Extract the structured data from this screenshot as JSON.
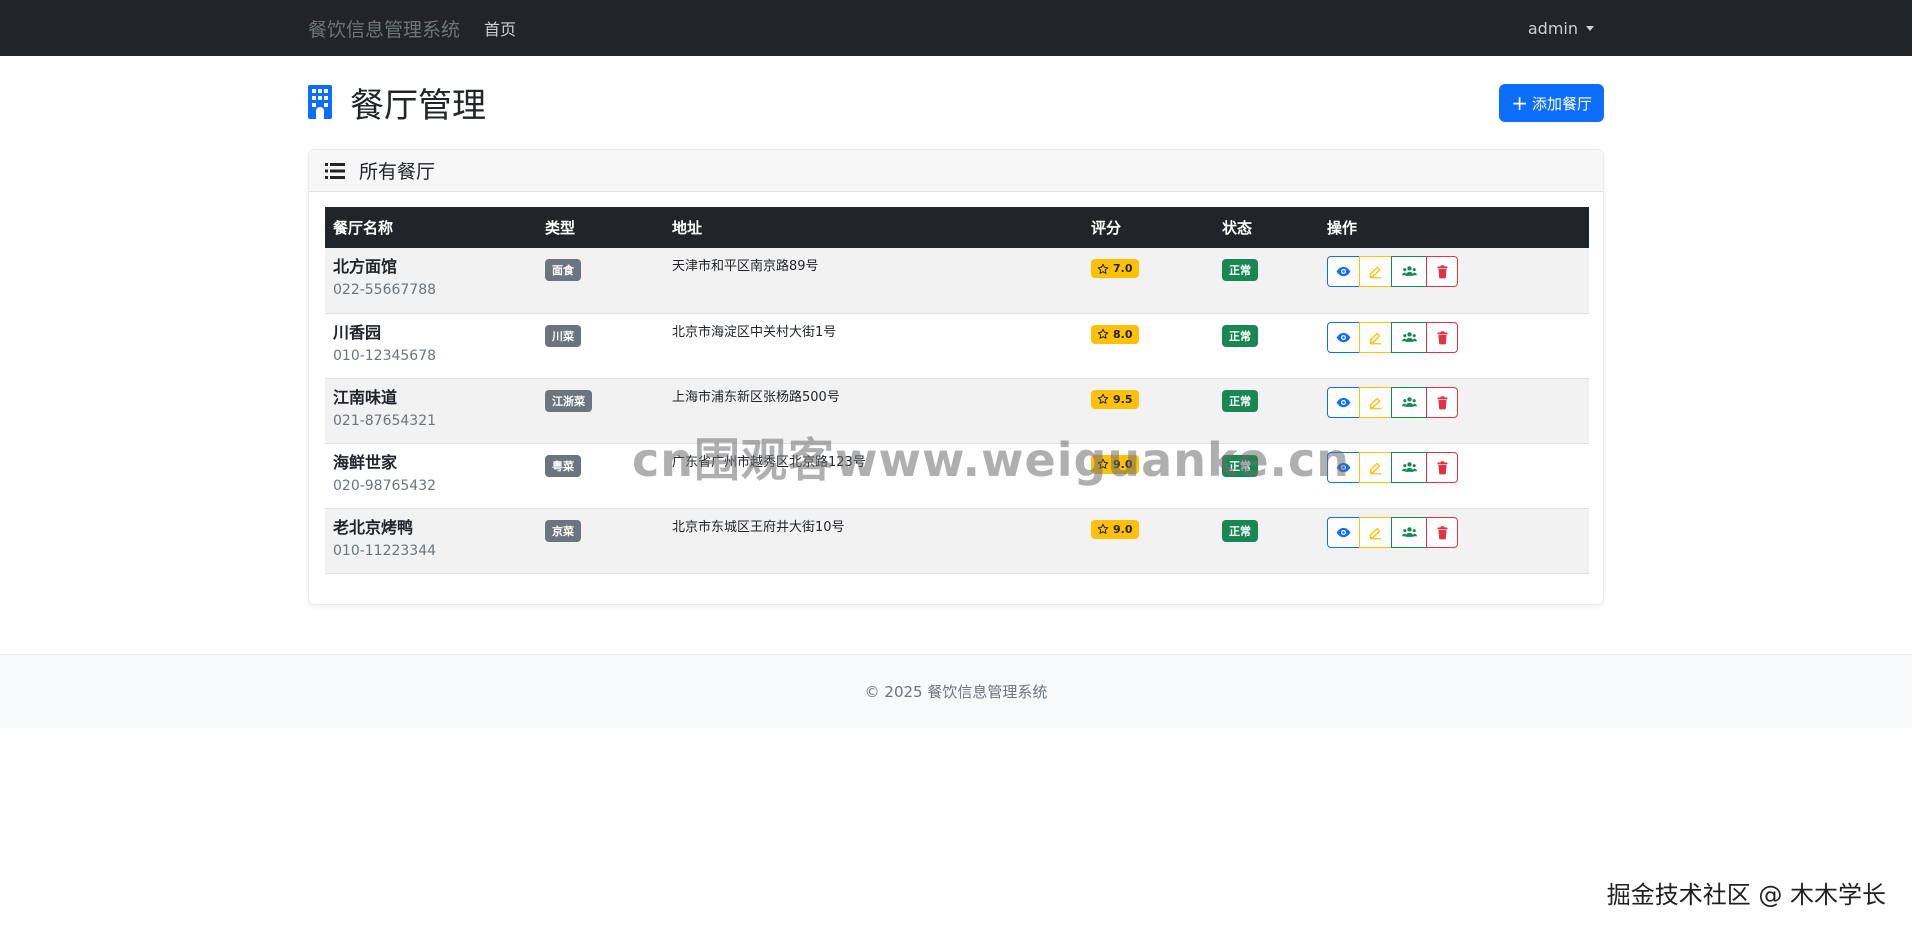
{
  "navbar": {
    "brand": "餐饮信息管理系统",
    "home_link": "首页",
    "user": "admin"
  },
  "page": {
    "title": "餐厅管理",
    "add_button": "添加餐厅"
  },
  "card": {
    "title": "所有餐厅"
  },
  "table": {
    "columns": [
      "餐厅名称",
      "类型",
      "地址",
      "评分",
      "状态",
      "操作"
    ],
    "rows": [
      {
        "name": "北方面馆",
        "phone": "022-55667788",
        "type": "面食",
        "address": "天津市和平区南京路89号",
        "rating": "7.0",
        "status": "正常"
      },
      {
        "name": "川香园",
        "phone": "010-12345678",
        "type": "川菜",
        "address": "北京市海淀区中关村大街1号",
        "rating": "8.0",
        "status": "正常"
      },
      {
        "name": "江南味道",
        "phone": "021-87654321",
        "type": "江浙菜",
        "address": "上海市浦东新区张杨路500号",
        "rating": "9.5",
        "status": "正常"
      },
      {
        "name": "海鲜世家",
        "phone": "020-98765432",
        "type": "粤菜",
        "address": "广东省广州市越秀区北京路123号",
        "rating": "9.0",
        "status": "正常"
      },
      {
        "name": "老北京烤鸭",
        "phone": "010-11223344",
        "type": "京菜",
        "address": "北京市东城区王府井大街10号",
        "rating": "9.0",
        "status": "正常"
      }
    ]
  },
  "footer": {
    "text": "© 2025 餐饮信息管理系统"
  },
  "watermarks": {
    "center": "cn围观客www.weiguanke.cn",
    "corner": "掘金技术社区 @ 木木学长"
  },
  "colors": {
    "navbar_bg": "#212529",
    "primary": "#0d6efd",
    "warning": "#ffc107",
    "success": "#198754",
    "danger": "#dc3545",
    "secondary": "#6c757d"
  },
  "icons": {
    "page_title": "building-icon",
    "card_title": "list-icon",
    "add": "plus-icon",
    "rating": "star-icon",
    "actions": [
      "eye-icon",
      "edit-icon",
      "users-icon",
      "trash-icon"
    ]
  }
}
